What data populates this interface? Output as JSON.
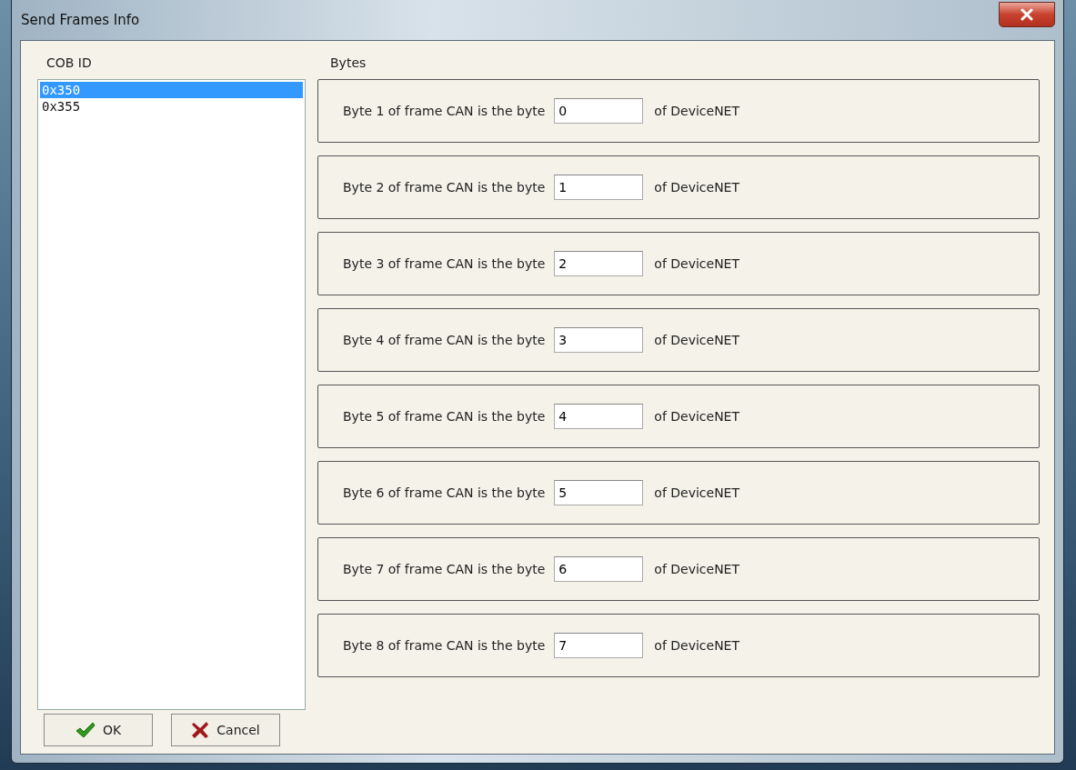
{
  "window": {
    "title": "Send Frames Info"
  },
  "cob_list": {
    "label": "COB ID",
    "items": [
      {
        "text": "0x350",
        "selected": true
      },
      {
        "text": "0x355",
        "selected": false
      }
    ]
  },
  "bytes": {
    "label": "Bytes",
    "rows": [
      {
        "text": "Byte 1 of frame CAN is the byte",
        "value": "0",
        "suffix": "of DeviceNET"
      },
      {
        "text": "Byte 2 of frame CAN is the byte",
        "value": "1",
        "suffix": "of DeviceNET"
      },
      {
        "text": "Byte 3 of frame CAN is the byte",
        "value": "2",
        "suffix": "of DeviceNET"
      },
      {
        "text": "Byte 4 of frame CAN is the byte",
        "value": "3",
        "suffix": "of DeviceNET"
      },
      {
        "text": "Byte 5 of frame CAN is the byte",
        "value": "4",
        "suffix": "of DeviceNET"
      },
      {
        "text": "Byte 6 of frame CAN is the byte",
        "value": "5",
        "suffix": "of DeviceNET"
      },
      {
        "text": "Byte 7 of frame CAN is the byte",
        "value": "6",
        "suffix": "of DeviceNET"
      },
      {
        "text": "Byte 8 of frame CAN is the byte",
        "value": "7",
        "suffix": "of DeviceNET"
      }
    ]
  },
  "buttons": [
    {
      "kind": "ok",
      "label": "OK"
    },
    {
      "kind": "cancel",
      "label": "Cancel"
    }
  ]
}
